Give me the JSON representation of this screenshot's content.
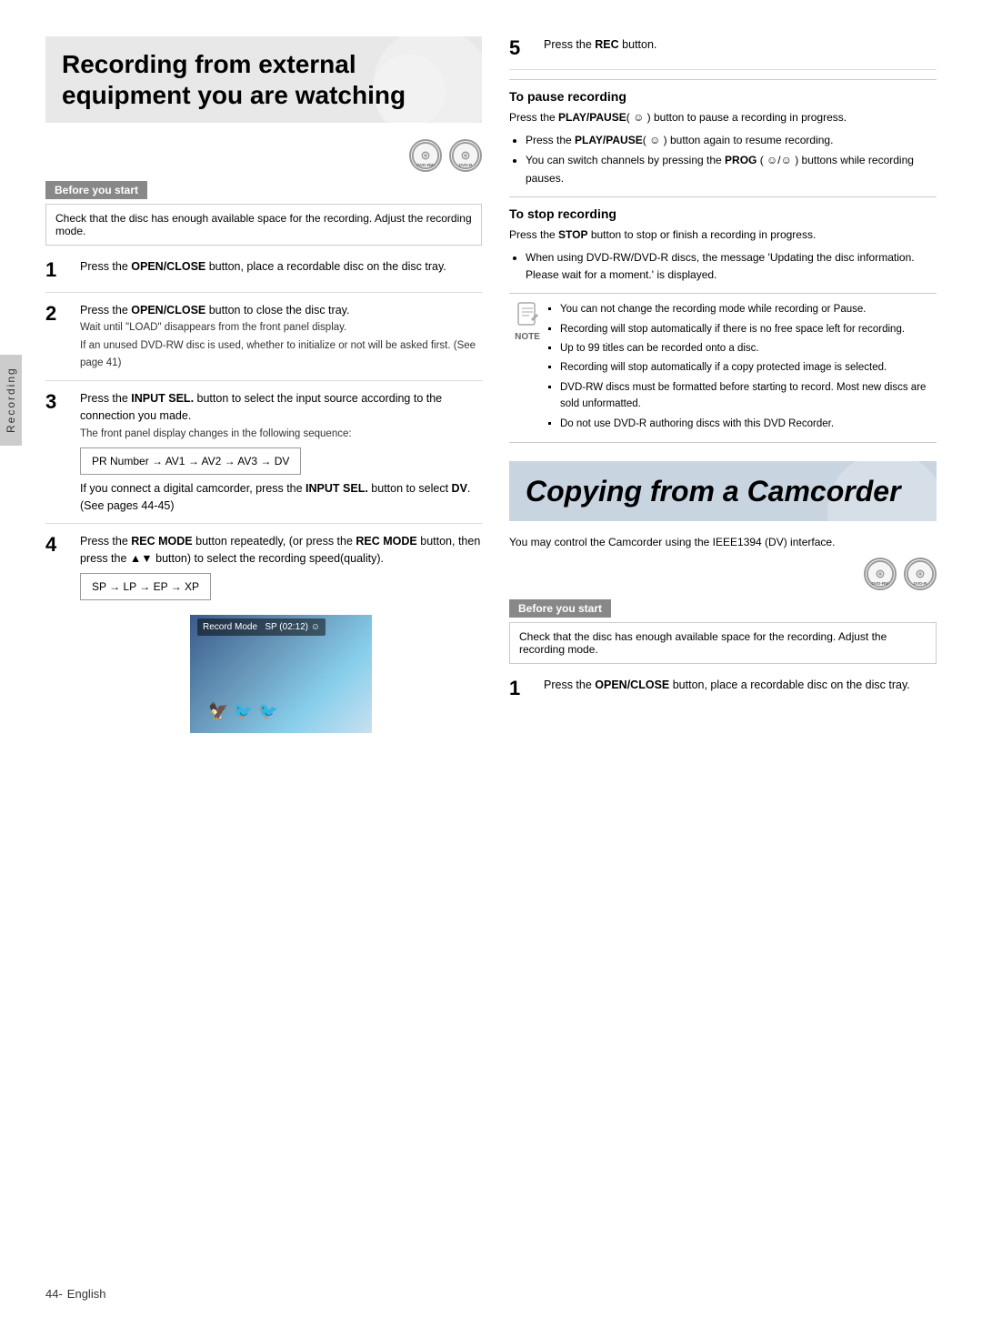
{
  "left": {
    "title": "Recording from external equipment you are watching",
    "discs": [
      "DVD-RW",
      "DVD-R"
    ],
    "before_start_label": "Before you start",
    "before_start_text": "Check that the disc has enough available space for the recording. Adjust the recording mode.",
    "steps": [
      {
        "num": "1",
        "main": "Press the OPEN/CLOSE button, place a recordable disc on the disc tray.",
        "note": ""
      },
      {
        "num": "2",
        "main": "Press the OPEN/CLOSE button to close the disc tray.",
        "note1": "Wait until \"LOAD\" disappears from the front panel display.",
        "note2": "If an unused DVD-RW disc is used, whether to initialize or not will be asked first. (See page 41)"
      },
      {
        "num": "3",
        "main": "Press the INPUT SEL. button to select the input source according to the connection you made.",
        "subnote": "The front panel display changes in the following sequence:",
        "sequence": "PR Number → AV1 → AV2 → AV3 → DV",
        "extra": "If you connect a digital camcorder, press the INPUT SEL. button to select DV. (See pages 44-45)"
      },
      {
        "num": "4",
        "main": "Press the REC MODE button repeatedly, (or press the REC MODE button, then press the ▲▼ button) to select the recording speed(quality).",
        "sequence2": "SP → LP → EP → XP",
        "screen_text": "Record Mode   SP (02:12) ☺"
      }
    ],
    "recording_tab": "Recording"
  },
  "right": {
    "step5_num": "5",
    "step5_text": "Press the REC button.",
    "pause_title": "To pause recording",
    "pause_text": "Press the PLAY/PAUSE( ☺ ) button to pause a recording in progress.",
    "pause_bullets": [
      "Press the PLAY/PAUSE( ☺ ) button again to resume recording.",
      "You can switch channels by pressing the PROG ( ☺/☺ ) buttons while recording pauses."
    ],
    "stop_title": "To stop recording",
    "stop_text": "Press the STOP button to stop or finish a recording in progress.",
    "stop_bullets": [
      "When using DVD-RW/DVD-R discs, the message 'Updating the disc information. Please wait for a moment.' is displayed."
    ],
    "notes": [
      "You can not change the recording mode while recording or Pause.",
      "Recording will stop automatically if there is no free space left for recording.",
      "Up to 99 titles can be recorded onto a disc.",
      "Recording will stop automatically if a copy protected image is selected.",
      "DVD-RW discs must be formatted before starting to record. Most new discs are sold unformatted.",
      "Do not use DVD-R authoring discs with this DVD Recorder."
    ],
    "note_label": "NOTE",
    "camcorder": {
      "title": "Copying from a Camcorder",
      "discs": [
        "DVD-RW",
        "DVD-R"
      ],
      "intro": "You may control the Camcorder using the IEEE1394 (DV) interface.",
      "before_start_label": "Before you start",
      "before_start_text": "Check that the disc has enough available space for the recording. Adjust the recording mode.",
      "step1_num": "1",
      "step1_text": "Press the OPEN/CLOSE button, place a recordable disc on the disc tray."
    }
  },
  "footer": {
    "page": "44-",
    "lang": "English"
  }
}
